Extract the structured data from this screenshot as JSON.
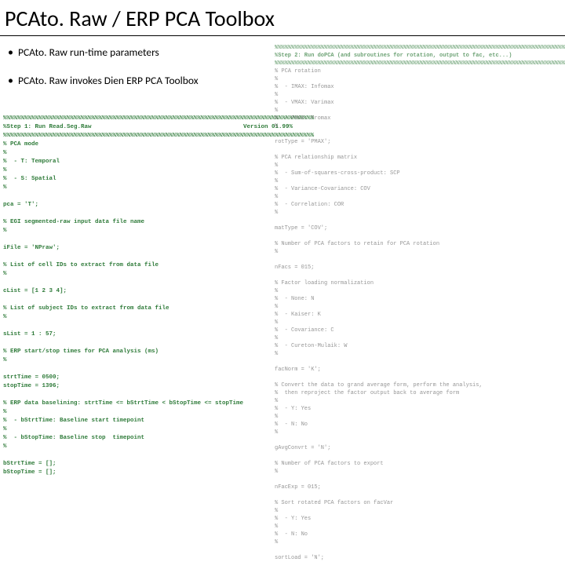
{
  "title": "PCAto. Raw / ERP PCA Toolbox",
  "bullets": [
    "PCAto. Raw run-time parameters",
    "PCAto. Raw invokes Dien ERP PCA Toolbox"
  ],
  "left_code": "%%%%%%%%%%%%%%%%%%%%%%%%%%%%%%%%%%%%%%%%%%%%%%%%%%%%%%%%%%%%%%%%%%%%%%%%%%%%%%%%%%%%%%%%\n%Step 1: Run Read.Seg.Raw                                           Version 01.99%\n%%%%%%%%%%%%%%%%%%%%%%%%%%%%%%%%%%%%%%%%%%%%%%%%%%%%%%%%%%%%%%%%%%%%%%%%%%%%%%%%%%%%%%%%\n% PCA mode\n%\n%  - T: Temporal\n%\n%  - S: Spatial\n%\n\npca = 'T';\n\n% EGI segmented-raw input data file name\n%\n\niFile = 'NPraw';\n\n% List of cell IDs to extract from data file\n%\n\ncList = [1 2 3 4];\n\n% List of subject IDs to extract from data file\n%\n\nsList = 1 : 57;\n\n% ERP start/stop times for PCA analysis (ms)\n%\n\nstrtTime = 0500;\nstopTime = 1396;\n\n% ERP data baselining: strtTime <= bStrtTime < bStopTime <= stopTime\n%\n%  - bStrtTime: Baseline start timepoint\n%\n%  - bStopTime: Baseline stop  timepoint\n%\n\nbStrtTime = [];\nbStopTime = [];",
  "right_code_header": "%%%%%%%%%%%%%%%%%%%%%%%%%%%%%%%%%%%%%%%%%%%%%%%%%%%%%%%%%%%%%%%%%%%%%%%%%%%%%%%%%%%%%%%%%%%%%%\n%Step 2: Run doPCA (and subroutines for rotation, output to fac, etc...)                   %\n%%%%%%%%%%%%%%%%%%%%%%%%%%%%%%%%%%%%%%%%%%%%%%%%%%%%%%%%%%%%%%%%%%%%%%%%%%%%%%%%%%%%%%%%%%%%%%",
  "right_code_body": "\n% PCA rotation\n%\n%  - IMAX: Infomax\n%\n%  - VMAX: Varimax\n%\n%  - PMAX: Promax\n%\n\nrotType = 'PMAX';\n\n% PCA relationship matrix\n%\n%  - Sum-of-squares-cross-product: SCP\n%\n%  - Variance-Covariance: COV\n%\n%  - Correlation: COR\n%\n\nmatType = 'COV';\n\n% Number of PCA factors to retain for PCA rotation\n%\n\nnFacs = 015;\n\n% Factor loading normalization\n%\n%  - None: N\n%\n%  - Kaiser: K\n%\n%  - Covariance: C\n%\n%  - Cureton-Mulaik: W\n%\n\nfacNorm = 'K';\n\n% Convert the data to grand average form, perform the analysis,\n%  then reproject the factor output back to average form\n%\n%  - Y: Yes\n%\n%  - N: No\n%\n\ngAvgConvrt = 'N';\n\n% Number of PCA factors to export\n%\n\nnFacExp = 015;\n\n% Sort rotated PCA factors on facVar\n%\n%  - Y: Yes\n%\n%  - N: No\n%\n\nsortLoad = 'N';"
}
